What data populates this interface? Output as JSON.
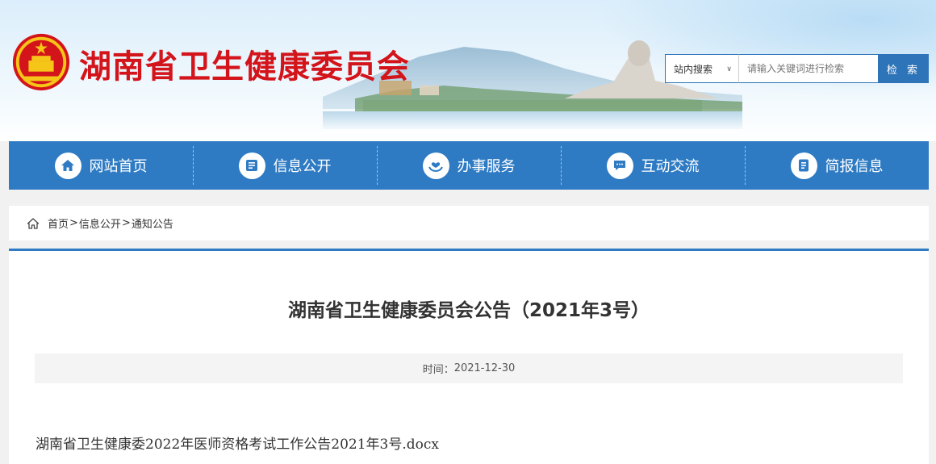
{
  "header": {
    "site_title": "湖南省卫生健康委员会",
    "brand_color": "#d4141b"
  },
  "search": {
    "scope_label": "站内搜索",
    "placeholder": "请输入关键词进行检索",
    "button_label": "检 索"
  },
  "nav": {
    "items": [
      {
        "label": "网站首页",
        "icon": "home-icon"
      },
      {
        "label": "信息公开",
        "icon": "document-list-icon"
      },
      {
        "label": "办事服务",
        "icon": "hands-heart-icon"
      },
      {
        "label": "互动交流",
        "icon": "chat-bubble-icon"
      },
      {
        "label": "简报信息",
        "icon": "report-icon"
      }
    ],
    "color": "#2e7bc4"
  },
  "breadcrumb": {
    "home": "首页",
    "sep": ">",
    "level1": "信息公开",
    "level2": "通知公告"
  },
  "article": {
    "title": "湖南省卫生健康委员会公告（2021年3号）",
    "time_label": "时间：",
    "time_value": "2021-12-30",
    "attachment": "湖南省卫生健康委2022年医师资格考试工作公告2021年3号.docx"
  }
}
